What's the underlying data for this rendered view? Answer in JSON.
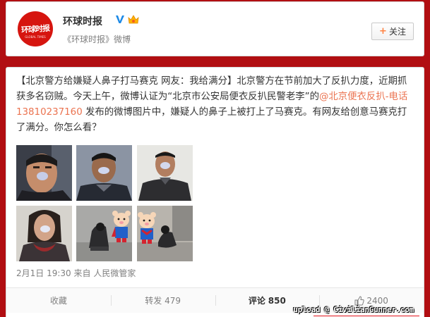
{
  "account": {
    "name": "环球时报",
    "source": "《环球时报》微博",
    "logo_text": "环球时报",
    "logo_subtext": "GLOBAL TIMES",
    "follow_label": "关注",
    "verified_icon": "verified-v-icon",
    "vip_icon": "vip-crown-icon"
  },
  "post": {
    "text_before": "【北京警方给嫌疑人鼻子打马赛克 网友：我给满分】北京警方在节前加大了反扒力度，近期抓获多名窃贼。今天上午，微博认证为“北京市公安局便衣反扒民警老李”的",
    "mention": "@北京便衣反扒-电话13810237160",
    "text_after": " 发布的微博图片中，嫌疑人的鼻子上被打上了马赛克。有网友给创意马赛克打了满分。你怎么看？",
    "images": [
      "suspect-photo-1",
      "suspect-photo-2",
      "suspect-photo-3",
      "suspect-photo-4",
      "suspects-with-cartoon-photo",
      "suspect-crouching-photo"
    ],
    "time": "2月1日 19:30",
    "via_prefix": " 来自 ",
    "via": "人民微管家"
  },
  "actions": {
    "favorite": "收藏",
    "repost_label": "转发",
    "repost_count": "479",
    "comment_label": "评论",
    "comment_count": "850",
    "like_count": "2400"
  },
  "watermark": "upload @ CivilianGunner.com",
  "colors": {
    "background": "#b10e12",
    "link": "#eb7350",
    "logo_red": "#d6150f"
  }
}
